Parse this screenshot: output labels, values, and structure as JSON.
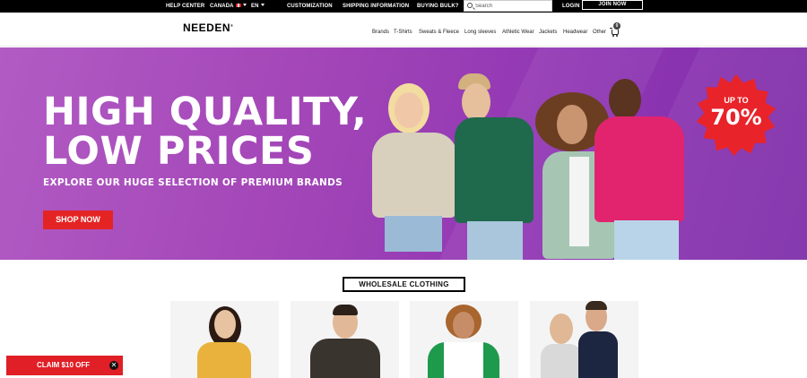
{
  "topbar": {
    "help_center": "HELP CENTER",
    "country": "CANADA",
    "language": "EN",
    "customization": "CUSTOMIZATION",
    "shipping": "SHIPPING INFORMATION",
    "buying_bulk": "BUYING BULK?",
    "search_placeholder": "Search",
    "login": "LOGIN",
    "join_now": "JOIN NOW"
  },
  "nav": {
    "logo": "NEEDEN",
    "logo_mark": "®",
    "items": [
      "Brands",
      "T-Shirts",
      "Sweats & Fleece",
      "Long sleeves",
      "Athletic Wear",
      "Jackets",
      "Headwear",
      "Other"
    ],
    "cart_count": "0"
  },
  "hero": {
    "title_line1": "HIGH QUALITY,",
    "title_line2": "LOW PRICES",
    "subtitle": "EXPLORE OUR HUGE SELECTION OF PREMIUM BRANDS",
    "cta": "SHOP NOW",
    "promo_top": "UP TO",
    "promo_value": "70%"
  },
  "section": {
    "title": "WHOLESALE CLOTHING"
  },
  "products": [
    {
      "shirt_color": "#e8b23c",
      "skin": "#e8c3a2",
      "hair": "#2a1a12"
    },
    {
      "shirt_color": "#3a342e",
      "skin": "#e2b998",
      "hair": "#2b211a"
    },
    {
      "shirt_color": "#ffffff",
      "sleeve_color": "#1e9a4c",
      "skin": "#c68d68",
      "hair": "#a8652e"
    },
    {
      "shirt_color": "#d9d9d9",
      "skin": "#e0b896",
      "hair": "#3a2a1e",
      "shirt_color_2": "#1d2640"
    }
  ],
  "claim": {
    "label": "CLAIM $10 OFF",
    "close": "✕"
  },
  "colors": {
    "hero_purple": "#a447b8",
    "accent_red": "#e42424",
    "topbar_black": "#000000"
  }
}
